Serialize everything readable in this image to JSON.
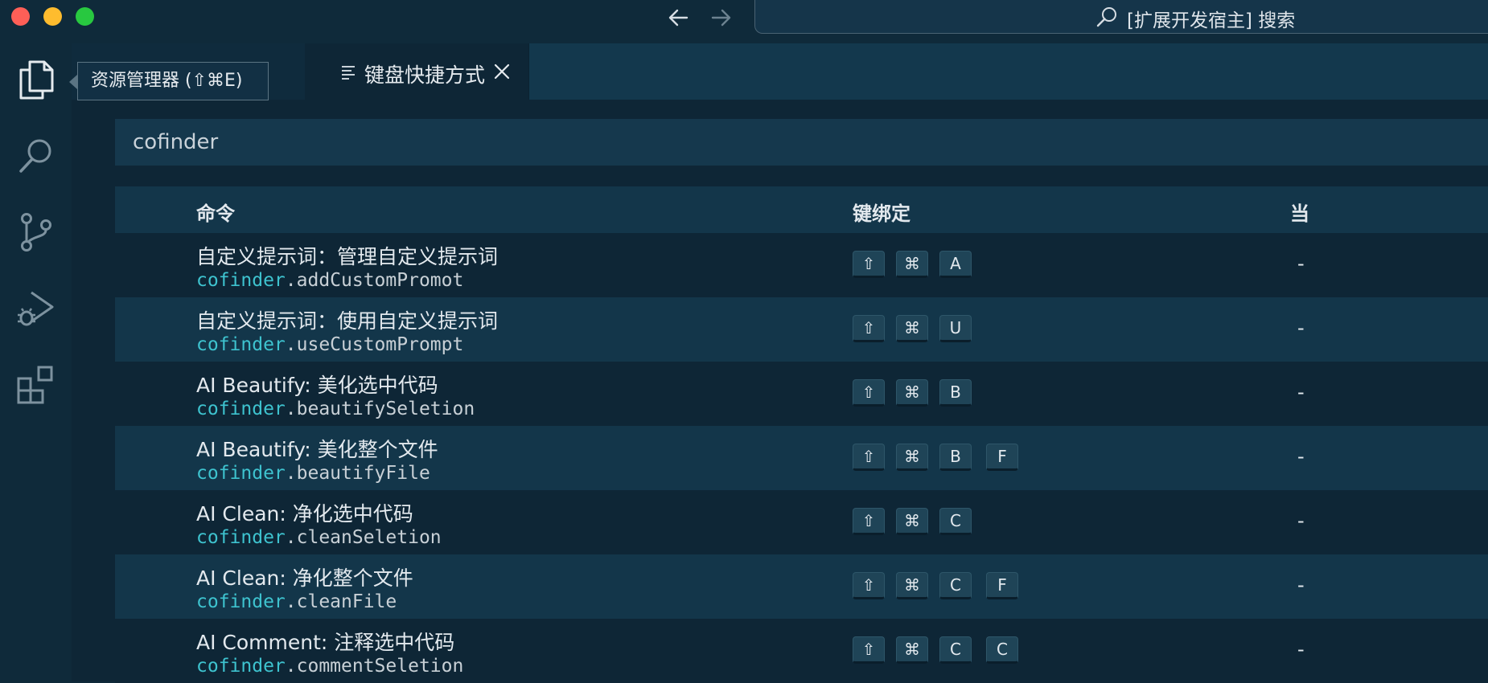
{
  "titlebar": {
    "command_center": "[扩展开发宿主] 搜索"
  },
  "tooltip": {
    "explorer": "资源管理器 (⇧⌘E)"
  },
  "tab": {
    "label": "键盘快捷方式"
  },
  "search": {
    "value": "cofinder"
  },
  "columns": {
    "command": "命令",
    "keybinding": "键绑定",
    "when": "当"
  },
  "keybindings": [
    {
      "title": "自定义提示词：管理自定义提示词",
      "ns": "cofinder",
      "id": ".addCustomPromot",
      "keys": [
        "⇧",
        "⌘",
        "A"
      ],
      "chord": "",
      "when": "-"
    },
    {
      "title": "自定义提示词：使用自定义提示词",
      "ns": "cofinder",
      "id": ".useCustomPrompt",
      "keys": [
        "⇧",
        "⌘",
        "U"
      ],
      "chord": "",
      "when": "-"
    },
    {
      "title": "AI Beautify: 美化选中代码",
      "ns": "cofinder",
      "id": ".beautifySeletion",
      "keys": [
        "⇧",
        "⌘",
        "B"
      ],
      "chord": "",
      "when": "-"
    },
    {
      "title": "AI Beautify: 美化整个文件",
      "ns": "cofinder",
      "id": ".beautifyFile",
      "keys": [
        "⇧",
        "⌘",
        "B"
      ],
      "chord": "F",
      "when": "-"
    },
    {
      "title": "AI Clean: 净化选中代码",
      "ns": "cofinder",
      "id": ".cleanSeletion",
      "keys": [
        "⇧",
        "⌘",
        "C"
      ],
      "chord": "",
      "when": "-"
    },
    {
      "title": "AI Clean: 净化整个文件",
      "ns": "cofinder",
      "id": ".cleanFile",
      "keys": [
        "⇧",
        "⌘",
        "C"
      ],
      "chord": "F",
      "when": "-"
    },
    {
      "title": "AI Comment: 注释选中代码",
      "ns": "cofinder",
      "id": ".commentSeletion",
      "keys": [
        "⇧",
        "⌘",
        "C"
      ],
      "chord": "C",
      "when": "-"
    }
  ],
  "icons": {
    "explorer": "files-icon",
    "search": "search-icon",
    "scm": "source-control-icon",
    "debug": "run-debug-icon",
    "extensions": "extensions-icon"
  },
  "colors": {
    "background": "#0f2a3a",
    "accent": "#3ec3cf"
  }
}
